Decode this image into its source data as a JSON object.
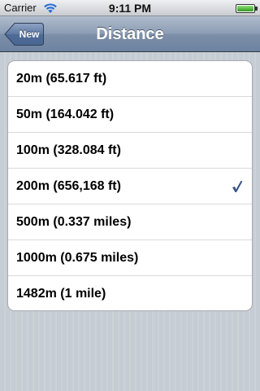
{
  "status_bar": {
    "carrier": "Carrier",
    "time": "9:11 PM",
    "wifi_icon": "wifi-icon",
    "battery_icon": "battery-icon"
  },
  "nav_bar": {
    "back_label": "New",
    "title": "Distance"
  },
  "distance_options": [
    {
      "label": "20m (65.617 ft)",
      "selected": false
    },
    {
      "label": "50m (164.042 ft)",
      "selected": false
    },
    {
      "label": "100m (328.084 ft)",
      "selected": false
    },
    {
      "label": "200m (656,168 ft)",
      "selected": true
    },
    {
      "label": "500m (0.337 miles)",
      "selected": false
    },
    {
      "label": "1000m (0.675 miles)",
      "selected": false
    },
    {
      "label": "1482m (1 mile)",
      "selected": false
    }
  ],
  "colors": {
    "checkmark": "#385487",
    "nav_bar": "#6d83a2",
    "background": "#c5ccd4"
  }
}
